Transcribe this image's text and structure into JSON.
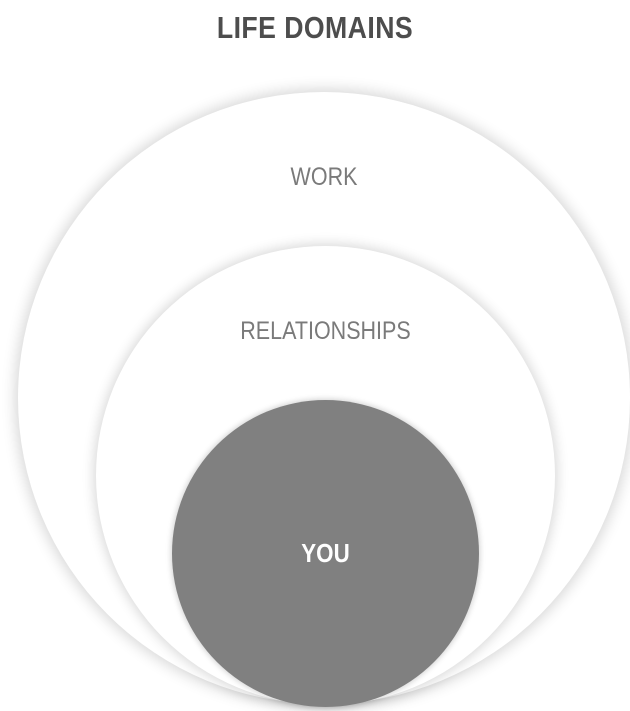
{
  "title": "LIFE DOMAINS",
  "domains": [
    {
      "label": "WORK",
      "fill": "#ffffff"
    },
    {
      "label": "RELATIONSHIPS",
      "fill": "#ffffff"
    },
    {
      "label": "YOU",
      "fill": "#808080"
    }
  ],
  "colors": {
    "title_text": "#4d4d4d",
    "outer_label_text": "#7a7a7a",
    "center_label_text": "#ffffff"
  }
}
